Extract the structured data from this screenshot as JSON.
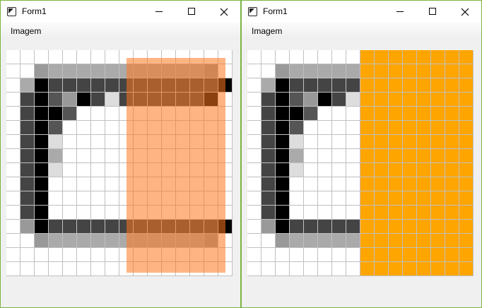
{
  "windows": [
    {
      "title": "Form1",
      "menu": "Imagem",
      "mode": "overlay"
    },
    {
      "title": "Form1",
      "menu": "Imagem",
      "mode": "fill"
    }
  ],
  "colors": {
    "border": "#7cb342",
    "grid_line": "#c0c0c0",
    "overlay": "rgba(255,120,30,0.55)",
    "fill": "#ffa500"
  },
  "image": {
    "palette": {
      "0": "#ffffff",
      "1": "#000000",
      "2": "#444444",
      "3": "#555555",
      "4": "#999999",
      "5": "#aaaaaa",
      "6": "#dddddd",
      "7": "#ffa500"
    },
    "pixels": [
      "0000000000000000",
      "0045555555555540",
      "0512222222222221",
      "0213412622222210",
      "0211300000000000",
      "0213000000000000",
      "0216000000000000",
      "0215000000000000",
      "0216000000000000",
      "0210000000000000",
      "0210000000000000",
      "0210000000000000",
      "0412222222222221",
      "0045555555555540",
      "0000000000000000",
      "0000000000000000"
    ],
    "fill_start_col": 8
  }
}
